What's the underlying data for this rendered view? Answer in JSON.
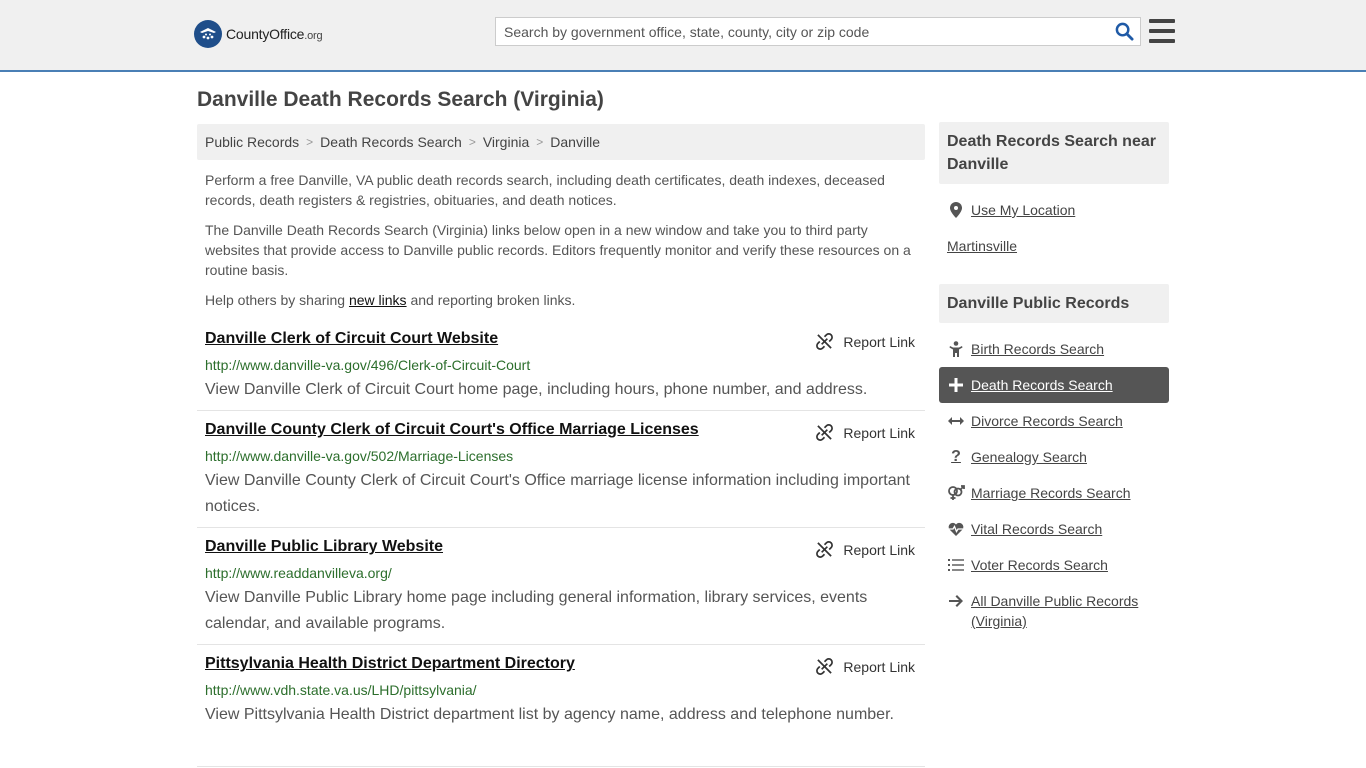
{
  "header": {
    "logo_main": "CountyOffice",
    "logo_org": ".org",
    "search_placeholder": "Search by government office, state, county, city or zip code"
  },
  "page_title": "Danville Death Records Search (Virginia)",
  "breadcrumb": [
    "Public Records",
    "Death Records Search",
    "Virginia",
    "Danville"
  ],
  "intro": {
    "p1": "Perform a free Danville, VA public death records search, including death certificates, death indexes, deceased records, death registers & registries, obituaries, and death notices.",
    "p2": "The Danville Death Records Search (Virginia) links below open in a new window and take you to third party websites that provide access to Danville public records. Editors frequently monitor and verify these resources on a routine basis.",
    "p3_before": "Help others by sharing ",
    "p3_link": "new links",
    "p3_after": " and reporting broken links."
  },
  "report_label": "Report Link",
  "listings": [
    {
      "title": "Danville Clerk of Circuit Court Website",
      "url": "http://www.danville-va.gov/496/Clerk-of-Circuit-Court",
      "desc": "View Danville Clerk of Circuit Court home page, including hours, phone number, and address."
    },
    {
      "title": "Danville County Clerk of Circuit Court's Office Marriage Licenses",
      "url": "http://www.danville-va.gov/502/Marriage-Licenses",
      "desc": "View Danville County Clerk of Circuit Court's Office marriage license information including important notices."
    },
    {
      "title": "Danville Public Library Website",
      "url": "http://www.readdanvilleva.org/",
      "desc": "View Danville Public Library home page including general information, library services, events calendar, and available programs."
    },
    {
      "title": "Pittsylvania Health District Department Directory",
      "url": "http://www.vdh.state.va.us/LHD/pittsylvania/",
      "desc": "View Pittsylvania Health District department list by agency name, address and telephone number."
    }
  ],
  "sidebar": {
    "near_title": "Death Records Search near Danville",
    "use_location": "Use My Location",
    "nearby": "Martinsville",
    "records_title": "Danville Public Records",
    "records": [
      {
        "label": "Birth Records Search",
        "icon": "child-icon"
      },
      {
        "label": "Death Records Search",
        "icon": "cross-icon",
        "active": true
      },
      {
        "label": "Divorce Records Search",
        "icon": "arrows-horizontal-icon"
      },
      {
        "label": "Genealogy Search",
        "icon": "question-icon"
      },
      {
        "label": "Marriage Records Search",
        "icon": "venus-mars-icon"
      },
      {
        "label": "Vital Records Search",
        "icon": "heartbeat-icon"
      },
      {
        "label": "Voter Records Search",
        "icon": "list-icon"
      },
      {
        "label": "All Danville Public Records (Virginia)",
        "icon": "arrow-right-icon"
      }
    ]
  },
  "colors": {
    "header_bg": "#f0f0f0",
    "header_border": "#4a7fb5",
    "url_green": "#2c6e2c",
    "active_bg": "#555555"
  }
}
